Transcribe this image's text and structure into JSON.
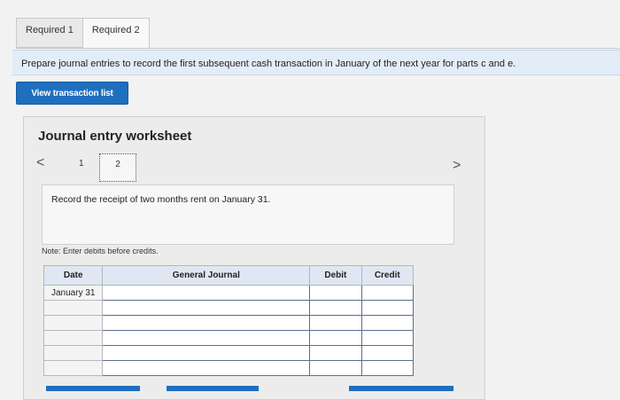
{
  "tabs": [
    {
      "label": "Required 1"
    },
    {
      "label": "Required 2"
    }
  ],
  "instruction": "Prepare journal entries to record the first subsequent cash transaction in January of the next year for parts c and e.",
  "view_button_label": "View transaction list",
  "worksheet": {
    "title": "Journal entry worksheet",
    "pager": {
      "prev": "<",
      "pages": [
        "1",
        "2"
      ],
      "next": ">"
    },
    "description": "Record the receipt of two months rent on January 31.",
    "note": "Note: Enter debits before credits.",
    "columns": {
      "date": "Date",
      "journal": "General Journal",
      "debit": "Debit",
      "credit": "Credit"
    },
    "rows": [
      {
        "date": "January 31"
      },
      {
        "date": ""
      },
      {
        "date": ""
      },
      {
        "date": ""
      },
      {
        "date": ""
      },
      {
        "date": ""
      }
    ]
  }
}
